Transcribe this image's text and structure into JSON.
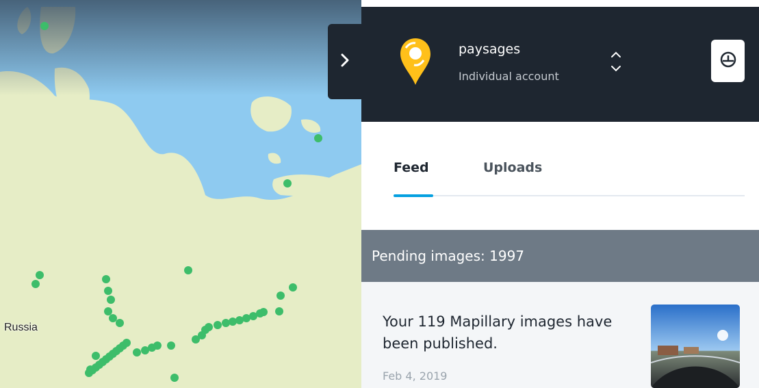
{
  "map": {
    "country_label": "Russia"
  },
  "sidebar_toggle": {
    "icon": "chevron-right-icon"
  },
  "account": {
    "name": "paysages",
    "type": "Individual account",
    "logo_icon": "map-pin-logo-icon",
    "switch_icon": "chevron-up-down-icon",
    "action_icon": "dashboard-gauge-icon"
  },
  "tabs": [
    {
      "label": "Feed",
      "active": true
    },
    {
      "label": "Uploads",
      "active": false
    }
  ],
  "pending": {
    "text": "Pending images: 1997"
  },
  "feed": {
    "items": [
      {
        "message": "Your 119 Mapillary images have been published.",
        "date": "Feb 4, 2019",
        "thumbnail_icon": "street-photo-thumbnail"
      }
    ]
  },
  "colors": {
    "header_bg": "#1e2630",
    "accent": "#05a0e0",
    "logo_yellow": "#ffc01a",
    "pending_bg": "#6e7a86",
    "map_water": "#8ecaf0",
    "map_land": "#e6edc6",
    "map_dots": "#3dbd6a"
  }
}
